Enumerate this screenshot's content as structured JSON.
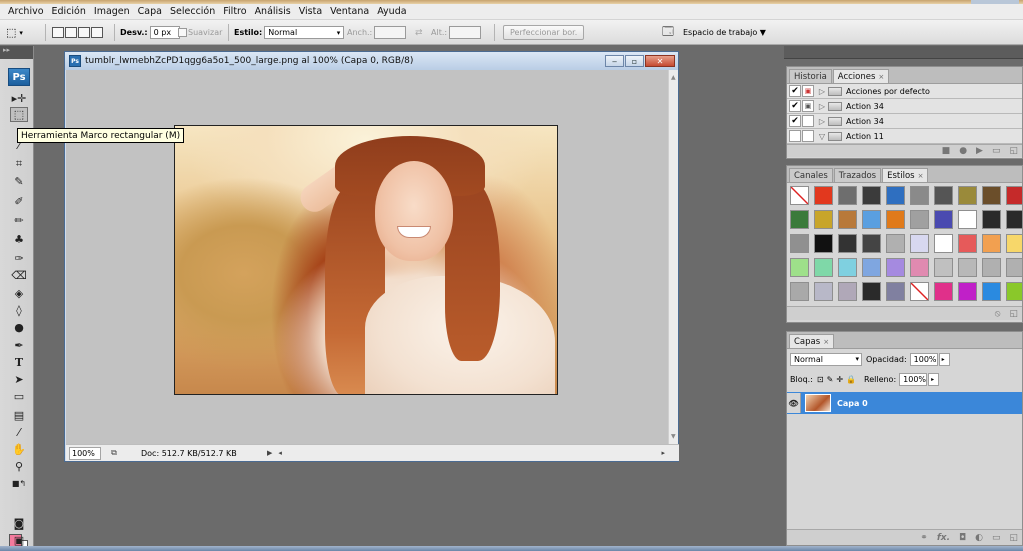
{
  "menu": [
    "Archivo",
    "Edición",
    "Imagen",
    "Capa",
    "Selección",
    "Filtro",
    "Análisis",
    "Vista",
    "Ventana",
    "Ayuda"
  ],
  "options": {
    "feather_label": "Desv.:",
    "feather_value": "0 px",
    "antialias_label": "Suavizar",
    "style_label": "Estilo:",
    "style_value": "Normal",
    "width_label": "Anch.:",
    "height_label": "Alt.:",
    "refine_label": "Perfeccionar bor.",
    "workspace_label": "Espacio de trabajo ▼"
  },
  "tools": {
    "app_logo": "Ps",
    "tooltip": "Herramienta Marco rectangular (M)",
    "icons": [
      "move-icon",
      "rect-marquee-icon",
      "lasso-icon",
      "quick-select-icon",
      "crop-icon",
      "eyedropper-icon",
      "healing-brush-icon",
      "brush-icon",
      "clone-stamp-icon",
      "history-brush-icon",
      "eraser-icon",
      "paint-bucket-icon",
      "blur-icon",
      "dodge-icon",
      "pen-icon",
      "type-icon",
      "path-select-icon",
      "shape-icon",
      "notes-icon",
      "eyedropper2-icon",
      "hand-icon",
      "zoom-icon"
    ],
    "fg_color": "#f47a9d",
    "bg_color": "#ffffff"
  },
  "document": {
    "title": "tumblr_lwmebhZcPD1qgg6a5o1_500_large.png al 100% (Capa 0, RGB/8)",
    "zoom": "100%",
    "doc_info": "Doc: 512.7 KB/512.7 KB"
  },
  "actions_panel": {
    "tabs": [
      {
        "label": "Historia",
        "active": false
      },
      {
        "label": "Acciones",
        "active": true
      }
    ],
    "rows": [
      {
        "label": "Acciones por defecto",
        "checked": true,
        "dialog": true,
        "expanded": false
      },
      {
        "label": "Action 34",
        "checked": true,
        "dialog": true,
        "expanded": false
      },
      {
        "label": "Action 34",
        "checked": true,
        "dialog": false,
        "expanded": false
      },
      {
        "label": "Action 11",
        "checked": false,
        "dialog": false,
        "expanded": true
      }
    ]
  },
  "styles_panel": {
    "tabs": [
      {
        "label": "Canales",
        "active": false
      },
      {
        "label": "Trazados",
        "active": false
      },
      {
        "label": "Estilos",
        "active": true
      }
    ],
    "swatches": [
      "none",
      "#e2381e",
      "#6e6e6e",
      "#3b3b3b",
      "#2f6fc0",
      "#8a8a8a",
      "#555555",
      "#9a8a3a",
      "#6b4e2a",
      "#c52a2a",
      "#3a7a3a",
      "#c8a52a",
      "#b8793a",
      "#5a9fe0",
      "#e07a1a",
      "#a0a0a0",
      "#4a4ab0",
      "#ffffff",
      "#2a2a2a",
      "#2a2a2a",
      "#909090",
      "#111111",
      "#333333",
      "#444444",
      "#b0b0b0",
      "#d8d8f0",
      "#ffffff",
      "#e65a5a",
      "#f2a050",
      "#f7d76a",
      "#9ee08a",
      "#7fd8a8",
      "#7fd0e0",
      "#7fa6e0",
      "#a58ae0",
      "#e08ab0",
      "#c0c0c0",
      "#b8b8b8",
      "#b0b0b0",
      "#b0b0b0",
      "#a9a9a9",
      "#b8b8c8",
      "#b0a8b8",
      "#2a2a2a",
      "#8080a0",
      "none",
      "#e0308a",
      "#c020c8",
      "#2a8ae0",
      "#8ac82a"
    ]
  },
  "layers_panel": {
    "tab": "Capas",
    "blend_mode": "Normal",
    "opacity_label": "Opacidad:",
    "opacity_value": "100%",
    "lock_label": "Bloq.:",
    "fill_label": "Relleno:",
    "fill_value": "100%",
    "layer_name": "Capa 0"
  }
}
